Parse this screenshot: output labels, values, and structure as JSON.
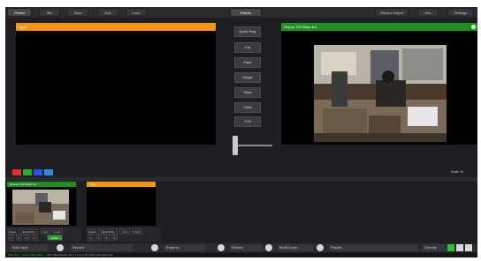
{
  "tabs_left": [
    "Preset",
    "Mix",
    "Save",
    "Edit",
    "Load"
  ],
  "tabs_center": [
    "Effects"
  ],
  "tabs_right": [
    "Stream Output",
    "Rec",
    "Settings"
  ],
  "preview_panel": {
    "title": "Input"
  },
  "output_panel": {
    "title": "Output 720 30fps 5.0"
  },
  "transitions": [
    "Quick Play",
    "Cut",
    "Fade",
    "Merge",
    "Wipe",
    "Cube",
    "7.00"
  ],
  "color_swatches": [
    "#e03030",
    "#2faa2f",
    "#3050e0",
    "#2f8ae0"
  ],
  "view_label": "Scale: M",
  "inputs": [
    {
      "title": "Browser 720 30fps 5.0",
      "header_color": "green",
      "controls": [
        "Close",
        "Quick Play",
        "Cut",
        "Loop",
        "1",
        "2",
        "3",
        "4",
        "Audio"
      ]
    },
    {
      "title": "Input",
      "header_color": "orange",
      "controls": [
        "Close",
        "Quick Play",
        "Cut",
        "Loop",
        "1",
        "2",
        "3",
        "4"
      ]
    }
  ],
  "bottom_bar": {
    "add_input": "Add Input",
    "items": [
      "Record",
      "External",
      "Stream",
      "MultiCorder",
      "Playlist"
    ],
    "overlay": "Overlay"
  },
  "status_bar": {
    "name": "vMix 29.0",
    "fps_label": "Frame Rate 30fps",
    "stats": "CPU 39%   Render Time 7.0 ms   GPU 48% Idle   Inputs 2/2"
  },
  "colors": {
    "accent_orange": "#f39612",
    "accent_green": "#1f8f1f",
    "background": "#1e1f22"
  }
}
